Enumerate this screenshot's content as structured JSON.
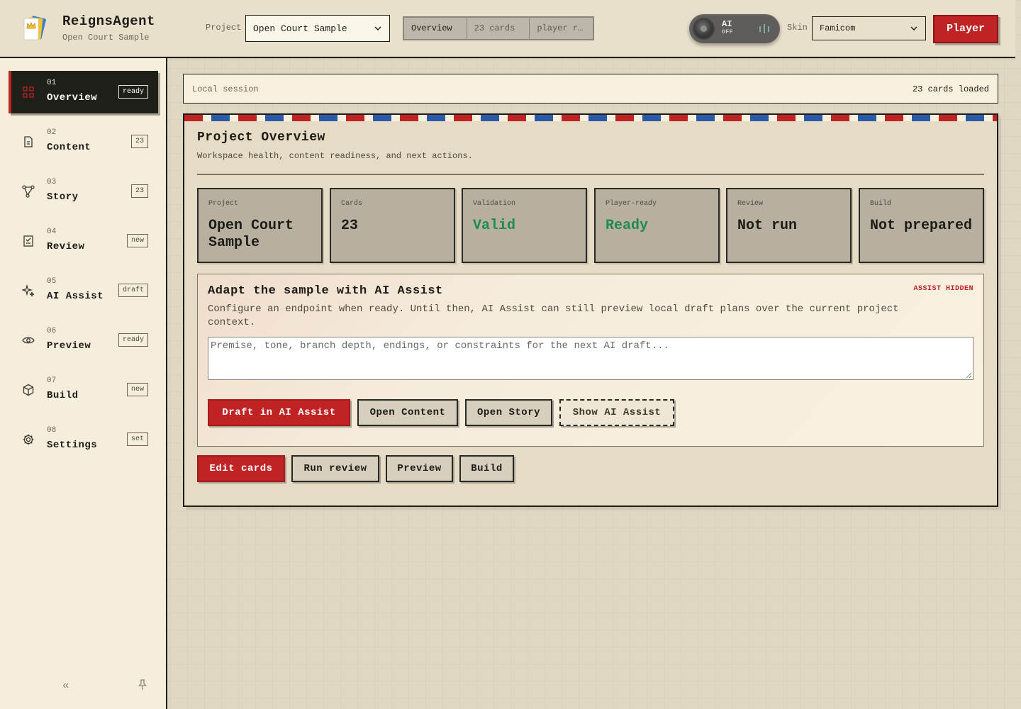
{
  "app": {
    "title": "ReignsAgent",
    "subtitle": "Open Court Sample"
  },
  "header": {
    "project_label": "Project",
    "project_value": "Open Court Sample",
    "crumbs": [
      "Overview",
      "23 cards",
      "player re…"
    ],
    "ai": {
      "label": "AI",
      "state": "OFF"
    },
    "skin_label": "Skin",
    "skin_value": "Famicom",
    "player_button": "Player"
  },
  "sidebar": {
    "items": [
      {
        "num": "01",
        "label": "Overview",
        "badge": "ready",
        "icon": "grid-icon"
      },
      {
        "num": "02",
        "label": "Content",
        "badge": "23",
        "icon": "document-icon"
      },
      {
        "num": "03",
        "label": "Story",
        "badge": "23",
        "icon": "branch-icon"
      },
      {
        "num": "04",
        "label": "Review",
        "badge": "new",
        "icon": "checklist-icon"
      },
      {
        "num": "05",
        "label": "AI Assist",
        "badge": "draft",
        "icon": "sparkle-icon"
      },
      {
        "num": "06",
        "label": "Preview",
        "badge": "ready",
        "icon": "eye-icon"
      },
      {
        "num": "07",
        "label": "Build",
        "badge": "new",
        "icon": "box-icon"
      },
      {
        "num": "08",
        "label": "Settings",
        "badge": "set",
        "icon": "gear-icon"
      }
    ],
    "collapse": "«"
  },
  "session": {
    "left": "Local session",
    "right": "23 cards loaded"
  },
  "overview": {
    "title": "Project Overview",
    "subtitle": "Workspace health, content readiness, and next actions.",
    "stats": [
      {
        "label": "Project",
        "value": "Open Court Sample"
      },
      {
        "label": "Cards",
        "value": "23"
      },
      {
        "label": "Validation",
        "value": "Valid"
      },
      {
        "label": "Player-ready",
        "value": "Ready"
      },
      {
        "label": "Review",
        "value": "Not run"
      },
      {
        "label": "Build",
        "value": "Not prepared"
      }
    ]
  },
  "assist": {
    "title": "Adapt the sample with AI Assist",
    "tag": "ASSIST HIDDEN",
    "description": "Configure an endpoint when ready. Until then, AI Assist can still preview local draft plans over the current project context.",
    "placeholder": "Premise, tone, branch depth, endings, or constraints for the next AI draft...",
    "buttons": [
      "Draft in AI Assist",
      "Open Content",
      "Open Story",
      "Show AI Assist"
    ]
  },
  "actions": [
    "Edit cards",
    "Run review",
    "Preview",
    "Build"
  ],
  "colors": {
    "accent": "#c02323",
    "success": "#1f8a52",
    "stripe_blue": "#2b5ba6"
  }
}
